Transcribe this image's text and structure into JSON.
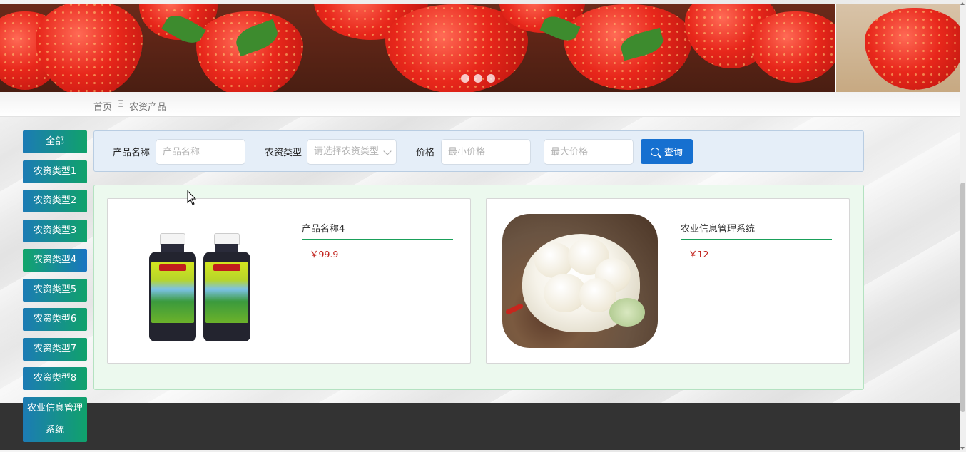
{
  "banner": {
    "slide_count": 3,
    "active_slide": 0
  },
  "breadcrumb": {
    "home": "首页",
    "separator": "Ξ",
    "current": "农资产品"
  },
  "sidebar": {
    "items": [
      {
        "label": "全部",
        "active": false
      },
      {
        "label": "农资类型1",
        "active": false
      },
      {
        "label": "农资类型2",
        "active": false
      },
      {
        "label": "农资类型3",
        "active": false
      },
      {
        "label": "农资类型4",
        "active": true
      },
      {
        "label": "农资类型5",
        "active": false
      },
      {
        "label": "农资类型6",
        "active": false
      },
      {
        "label": "农资类型7",
        "active": false
      },
      {
        "label": "农资类型8",
        "active": false
      },
      {
        "label": "农业信息管理系统",
        "active": false
      }
    ]
  },
  "search": {
    "name_label": "产品名称",
    "name_placeholder": "产品名称",
    "type_label": "农资类型",
    "type_placeholder": "请选择农资类型",
    "price_label": "价格",
    "min_price_placeholder": "最小价格",
    "max_price_placeholder": "最大价格",
    "query_button": "查询"
  },
  "products": [
    {
      "name": "产品名称4",
      "price": "￥99.9",
      "image": "pesticide-bottles"
    },
    {
      "name": "农业信息管理系统",
      "price": "￥12",
      "image": "cauliflower"
    }
  ],
  "colors": {
    "sidebar_gradient_start": "#1c7bb5",
    "sidebar_gradient_end": "#10a26b",
    "query_button": "#1670d0",
    "price": "#c0201a",
    "footer": "#333333",
    "product_panel_bg": "#ecf9ee",
    "search_panel_bg": "#e5eef8"
  }
}
